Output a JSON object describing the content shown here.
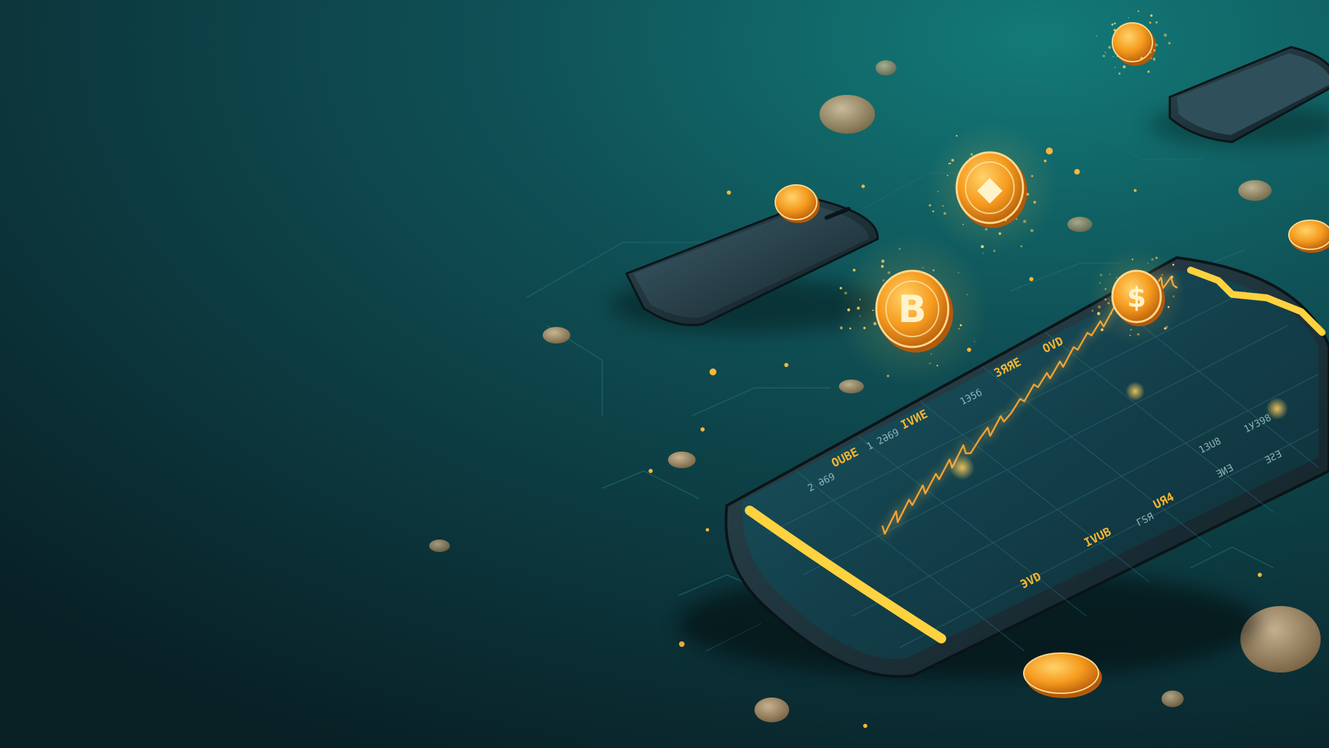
{
  "scene": {
    "description_tag": "",
    "palette": {
      "background_dark": "#0a2228",
      "background_teal": "#0f4f55",
      "coin_gold": "#f4a021",
      "coin_deep": "#c96a0d",
      "screen_accent": "#ffd23f",
      "chart_line": "#f59a2c"
    }
  },
  "phone": {
    "screen_labels": [
      "OVD",
      "3ЯЯЕ",
      "IVИE",
      "ОUBE",
      "UЯ4",
      "IVUB",
      "ЭVD"
    ],
    "dim_labels": [
      "1 2Ə69",
      "2 Ə69",
      "1Э5б",
      "1УЗ98",
      "1ЗU8",
      "ΓSЯ",
      "ƎƧƎ",
      "ƎИƎ"
    ],
    "chart_series": [
      42,
      38,
      45,
      40,
      47,
      44,
      50,
      46,
      52,
      49,
      55,
      51,
      58,
      54,
      53,
      57,
      60,
      56,
      62,
      59,
      61,
      65,
      63,
      68,
      66,
      70,
      67,
      72,
      69,
      75,
      73,
      78,
      76,
      80,
      77,
      83,
      85,
      92,
      88,
      86,
      84,
      87,
      82,
      85,
      80,
      83,
      79,
      77
    ]
  },
  "coins": [
    {
      "name": "bitcoin-coin",
      "glyph": "B"
    },
    {
      "name": "ethereum-coin",
      "glyph": "◆"
    },
    {
      "name": "dollar-coin",
      "glyph": "$"
    }
  ]
}
